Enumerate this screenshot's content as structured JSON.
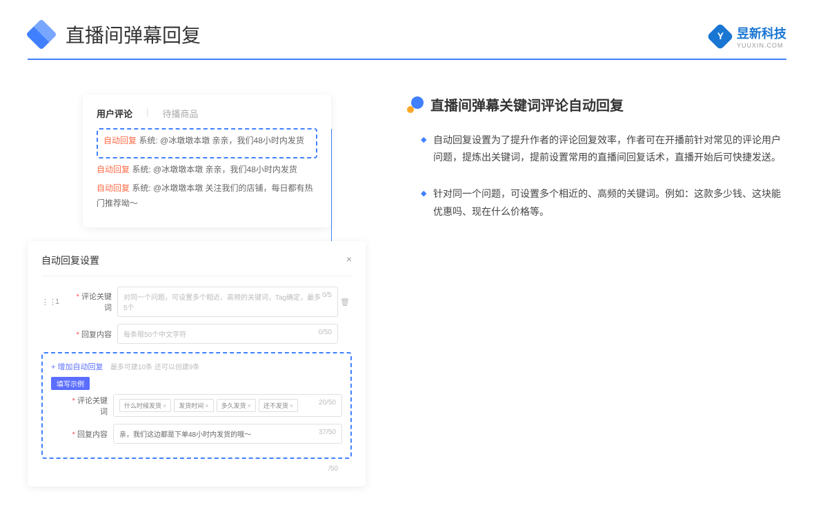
{
  "page_title": "直播间弹幕回复",
  "brand": {
    "name": "昱新科技",
    "sub": "YUUXIN.COM"
  },
  "card1": {
    "tab_active": "用户评论",
    "tab_inactive": "待播商品",
    "reply_tag": "自动回复",
    "line1": " 系统: @冰墩墩本墩 亲亲，我们48小时内发货",
    "line2": " 系统: @冰墩墩本墩 亲亲，我们48小时内发货",
    "line3": " 系统: @冰墩墩本墩 关注我们的店铺，每日都有热门推荐呦～"
  },
  "card2": {
    "title": "自动回复设置",
    "idx": "1",
    "label_keyword": "评论关键词",
    "placeholder_keyword": "对同一个问题，可设置多个相近、高频的关键词，Tag确定，最多5个",
    "keyword_count": "0/5",
    "label_content": "回复内容",
    "placeholder_content": "每条限50个中文字符",
    "content_count": "0/50",
    "add_link": "+ 增加自动回复",
    "add_hint": "最多可建10条 还可以创建9条",
    "example_badge": "填写示例",
    "example_tags": [
      "什么时候发货",
      "发货时间",
      "多久发货",
      "还不发货"
    ],
    "example_tag_count": "20/50",
    "example_content": "亲，我们这边都是下单48小时内发货的哦～",
    "example_content_count": "37/50",
    "trailing_count": "/50"
  },
  "right": {
    "heading": "直播间弹幕关键词评论自动回复",
    "bullets": [
      "自动回复设置为了提升作者的评论回复效率，作者可在开播前针对常见的评论用户问题，提炼出关键词，提前设置常用的直播间回复话术，直播开始后可快捷发送。",
      "针对同一个问题，可设置多个相近的、高频的关键词。例如：这款多少钱、这块能优惠吗、现在什么价格等。"
    ]
  }
}
